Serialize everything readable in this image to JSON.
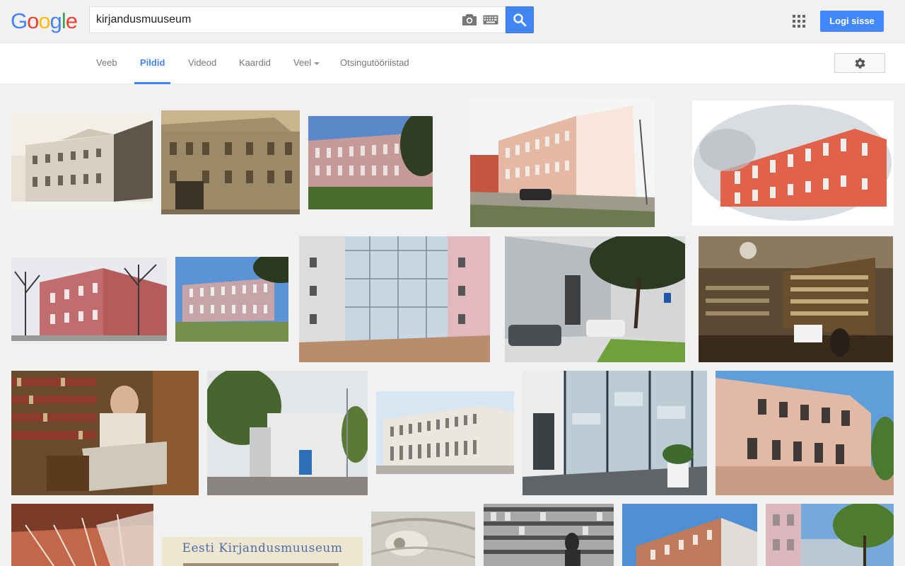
{
  "header": {
    "logo": {
      "letters": [
        "G",
        "o",
        "o",
        "g",
        "l",
        "e"
      ],
      "colors": [
        "#4285f4",
        "#ea4335",
        "#fbbc05",
        "#4285f4",
        "#34a853",
        "#ea4335"
      ]
    },
    "search_value": "kirjandusmuuseum",
    "signin_label": "Logi sisse"
  },
  "nav": {
    "tabs": [
      {
        "label": "Veeb"
      },
      {
        "label": "Pildid"
      },
      {
        "label": "Videod"
      },
      {
        "label": "Kaardid"
      },
      {
        "label": "Veel"
      },
      {
        "label": "Otsingutööriistad"
      }
    ],
    "active_tab": "Pildid"
  },
  "colors": {
    "accent": "#4285f4",
    "signin": "#4387fd"
  },
  "results": {
    "images": [
      {
        "subject": "sepia building facade"
      },
      {
        "subject": "old sepia building photo"
      },
      {
        "subject": "pink building with blue sky"
      },
      {
        "subject": "pink building street with car"
      },
      {
        "subject": "painted red building illustration"
      },
      {
        "subject": "red building winter trees"
      },
      {
        "subject": "pink building green lawn"
      },
      {
        "subject": "glass atrium courtyard"
      },
      {
        "subject": "modern grey building with tree"
      },
      {
        "subject": "library reading room"
      },
      {
        "subject": "woman with books"
      },
      {
        "subject": "white modern building"
      },
      {
        "subject": "white classical palace"
      },
      {
        "subject": "glass wall interior"
      },
      {
        "subject": "ornate pink facade"
      },
      {
        "subject": "wooden roof interior"
      },
      {
        "subject": "museum banner"
      },
      {
        "subject": "ornate ceiling"
      },
      {
        "subject": "archive shelves black and white"
      },
      {
        "subject": "red building blue sky"
      },
      {
        "subject": "building with tree"
      }
    ],
    "banner_text": "Eesti Kirjandusmuuseum"
  }
}
